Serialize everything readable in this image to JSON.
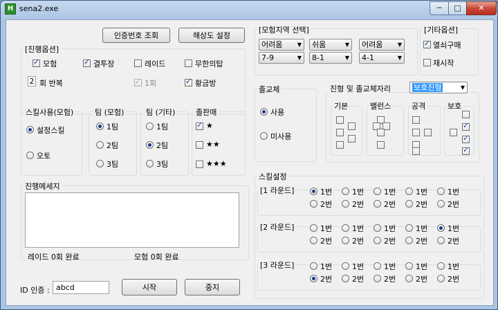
{
  "window": {
    "title": "sena2.exe",
    "icon": "app-icon",
    "min": "─",
    "max": "□",
    "close": "✕"
  },
  "top_buttons": {
    "auth": "인증번호 조회",
    "resolution": "해상도 설정"
  },
  "progress_options": {
    "title": "[진행옵션]",
    "adventure": {
      "label": "모험",
      "checked": true
    },
    "arena": {
      "label": "결투장",
      "checked": true
    },
    "raid": {
      "label": "레이드",
      "checked": false
    },
    "infinite_tower": {
      "label": "무한의탑",
      "checked": false
    },
    "repeat_count": "2",
    "repeat_label": "회 반복",
    "once": {
      "label": "1회",
      "checked": true
    },
    "gold_room": {
      "label": "황금방",
      "checked": true
    }
  },
  "skill_use": {
    "title": "스킬사용(모험)",
    "options": [
      {
        "label": "설정스킬",
        "checked": true
      },
      {
        "label": "오토",
        "checked": false
      }
    ]
  },
  "team_adventure": {
    "title": "팀 (모험)",
    "options": [
      {
        "label": "1팀",
        "checked": true
      },
      {
        "label": "2팀",
        "checked": false
      },
      {
        "label": "3팀",
        "checked": false
      }
    ]
  },
  "team_other": {
    "title": "팀 (기타)",
    "options": [
      {
        "label": "1팀",
        "checked": false
      },
      {
        "label": "2팀",
        "checked": true
      },
      {
        "label": "3팀",
        "checked": false
      }
    ]
  },
  "sell": {
    "title": "졸판매",
    "options": [
      {
        "label": "★",
        "checked": true
      },
      {
        "label": "★★",
        "checked": false
      },
      {
        "label": "★★★",
        "checked": false
      }
    ]
  },
  "messages": {
    "title": "진행메세지",
    "raid_status": "레이드 0회 완료",
    "adventure_status": "모험 0회 완료"
  },
  "id_auth": {
    "label": "ID 인증 :",
    "value": "abcd"
  },
  "actions": {
    "start": "시작",
    "stop": "중지"
  },
  "region": {
    "title": "[모험지역 선택]",
    "difficulties": [
      "어려움",
      "쉬움",
      "어려움"
    ],
    "stages": [
      "7-9",
      "8-1",
      "4-1"
    ]
  },
  "other_options": {
    "title": "[기타옵션]",
    "key_buy": {
      "label": "열쇠구매",
      "checked": true
    },
    "restart": {
      "label": "재시작",
      "checked": false
    }
  },
  "replacement": {
    "title": "졸교체",
    "use": {
      "label": "사용",
      "checked": true
    },
    "not_use": {
      "label": "미사용",
      "checked": false
    }
  },
  "formation": {
    "title": "진형 및 졸교체자리",
    "selected": "보호진형",
    "groups": [
      "기본",
      "밸런스",
      "공격",
      "보호"
    ]
  },
  "skill_settings": {
    "title": "스킬설정",
    "rounds": [
      {
        "label": "[1 라운드]",
        "row1_label": "1번",
        "row2_label": "2번",
        "row1": [
          true,
          false,
          false,
          false,
          false
        ],
        "row2": [
          false,
          false,
          false,
          false,
          false
        ]
      },
      {
        "label": "[2 라운드]",
        "row1_label": "1번",
        "row2_label": "2번",
        "row1": [
          false,
          false,
          false,
          false,
          true
        ],
        "row2": [
          false,
          false,
          false,
          false,
          false
        ]
      },
      {
        "label": "[3 라운드]",
        "row1_label": "1번",
        "row2_label": "2번",
        "row1": [
          false,
          false,
          false,
          false,
          false
        ],
        "row2": [
          true,
          false,
          false,
          false,
          false
        ]
      }
    ]
  }
}
